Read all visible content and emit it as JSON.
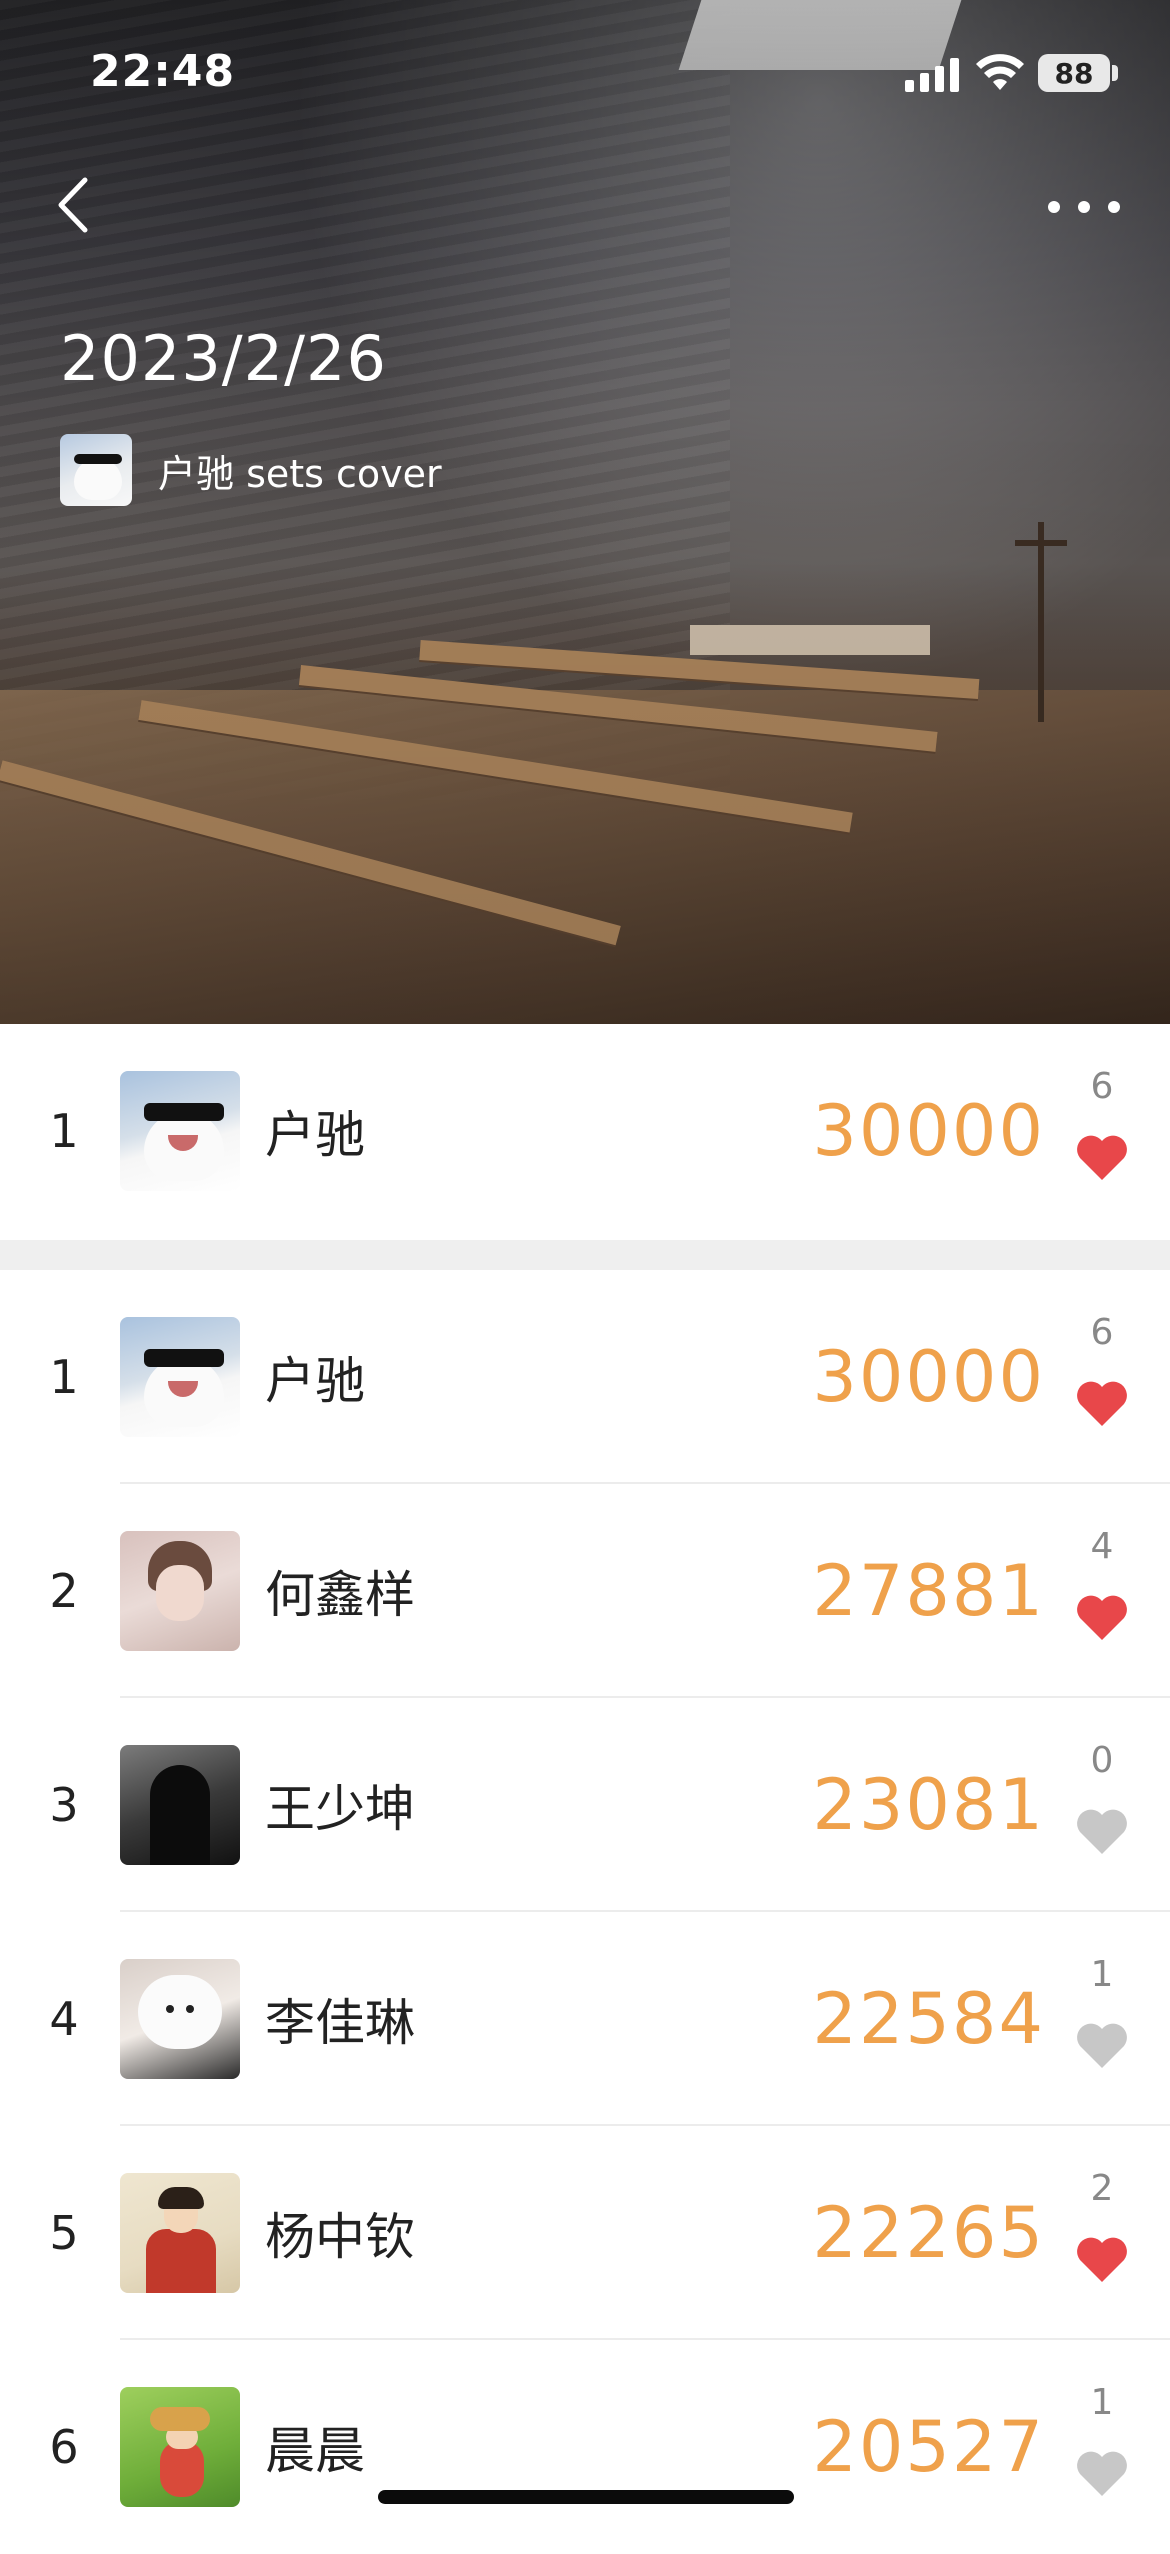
{
  "status_bar": {
    "time": "22:48",
    "battery": "88"
  },
  "cover": {
    "title": "2023/2/26",
    "setter_label": "户驰 sets cover"
  },
  "icons": {
    "back": "chevron-left-icon",
    "more": "more-horizontal-icon",
    "like_filled": "heart-filled-icon",
    "like_empty": "heart-outline-icon"
  },
  "colors": {
    "steps": "#efa14b",
    "heart_liked": "#e8474a",
    "heart_unliked": "#c7c7c7"
  },
  "my_rank": {
    "rank": "1",
    "name": "户驰",
    "steps": "30000",
    "likes": "6",
    "liked": true
  },
  "ranking": [
    {
      "rank": "1",
      "name": "户驰",
      "steps": "30000",
      "likes": "6",
      "liked": true
    },
    {
      "rank": "2",
      "name": "何鑫样",
      "steps": "27881",
      "likes": "4",
      "liked": true
    },
    {
      "rank": "3",
      "name": "王少坤",
      "steps": "23081",
      "likes": "0",
      "liked": false
    },
    {
      "rank": "4",
      "name": "李佳琳",
      "steps": "22584",
      "likes": "1",
      "liked": false
    },
    {
      "rank": "5",
      "name": "杨中钦",
      "steps": "22265",
      "likes": "2",
      "liked": true
    },
    {
      "rank": "6",
      "name": "晨晨",
      "steps": "20527",
      "likes": "1",
      "liked": false
    }
  ]
}
